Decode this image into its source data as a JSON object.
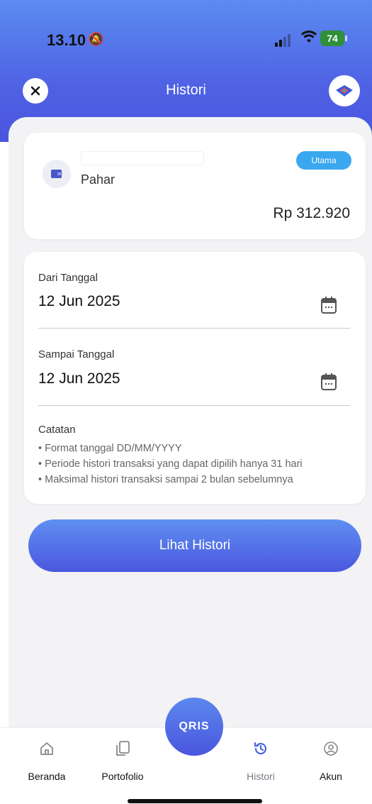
{
  "status_bar": {
    "time": "13.10",
    "battery": "74"
  },
  "header": {
    "title": "Histori"
  },
  "account": {
    "name": "Pahar",
    "badge": "Utama",
    "balance": "Rp 312.920"
  },
  "date_form": {
    "from_label": "Dari Tanggal",
    "from_value": "12 Jun 2025",
    "to_label": "Sampai Tanggal",
    "to_value": "12 Jun 2025"
  },
  "notes": {
    "title": "Catatan",
    "items": [
      "Format tanggal DD/MM/YYYY",
      "Periode histori transaksi yang dapat dipilih hanya 31 hari",
      "Maksimal histori transaksi sampai 2 bulan sebelumnya"
    ]
  },
  "cta": {
    "label": "Lihat Histori"
  },
  "bottom_nav": {
    "items": [
      {
        "label": "Beranda",
        "icon": "home-icon"
      },
      {
        "label": "Portofolio",
        "icon": "portfolio-icon"
      },
      {
        "label": "Histori",
        "icon": "history-icon",
        "active": true
      },
      {
        "label": "Akun",
        "icon": "account-icon"
      }
    ],
    "qris_label": "QRIS"
  },
  "colors": {
    "primary": "#4f62e4",
    "badge": "#3aa7ef",
    "active_nav": "#4a66e0"
  }
}
